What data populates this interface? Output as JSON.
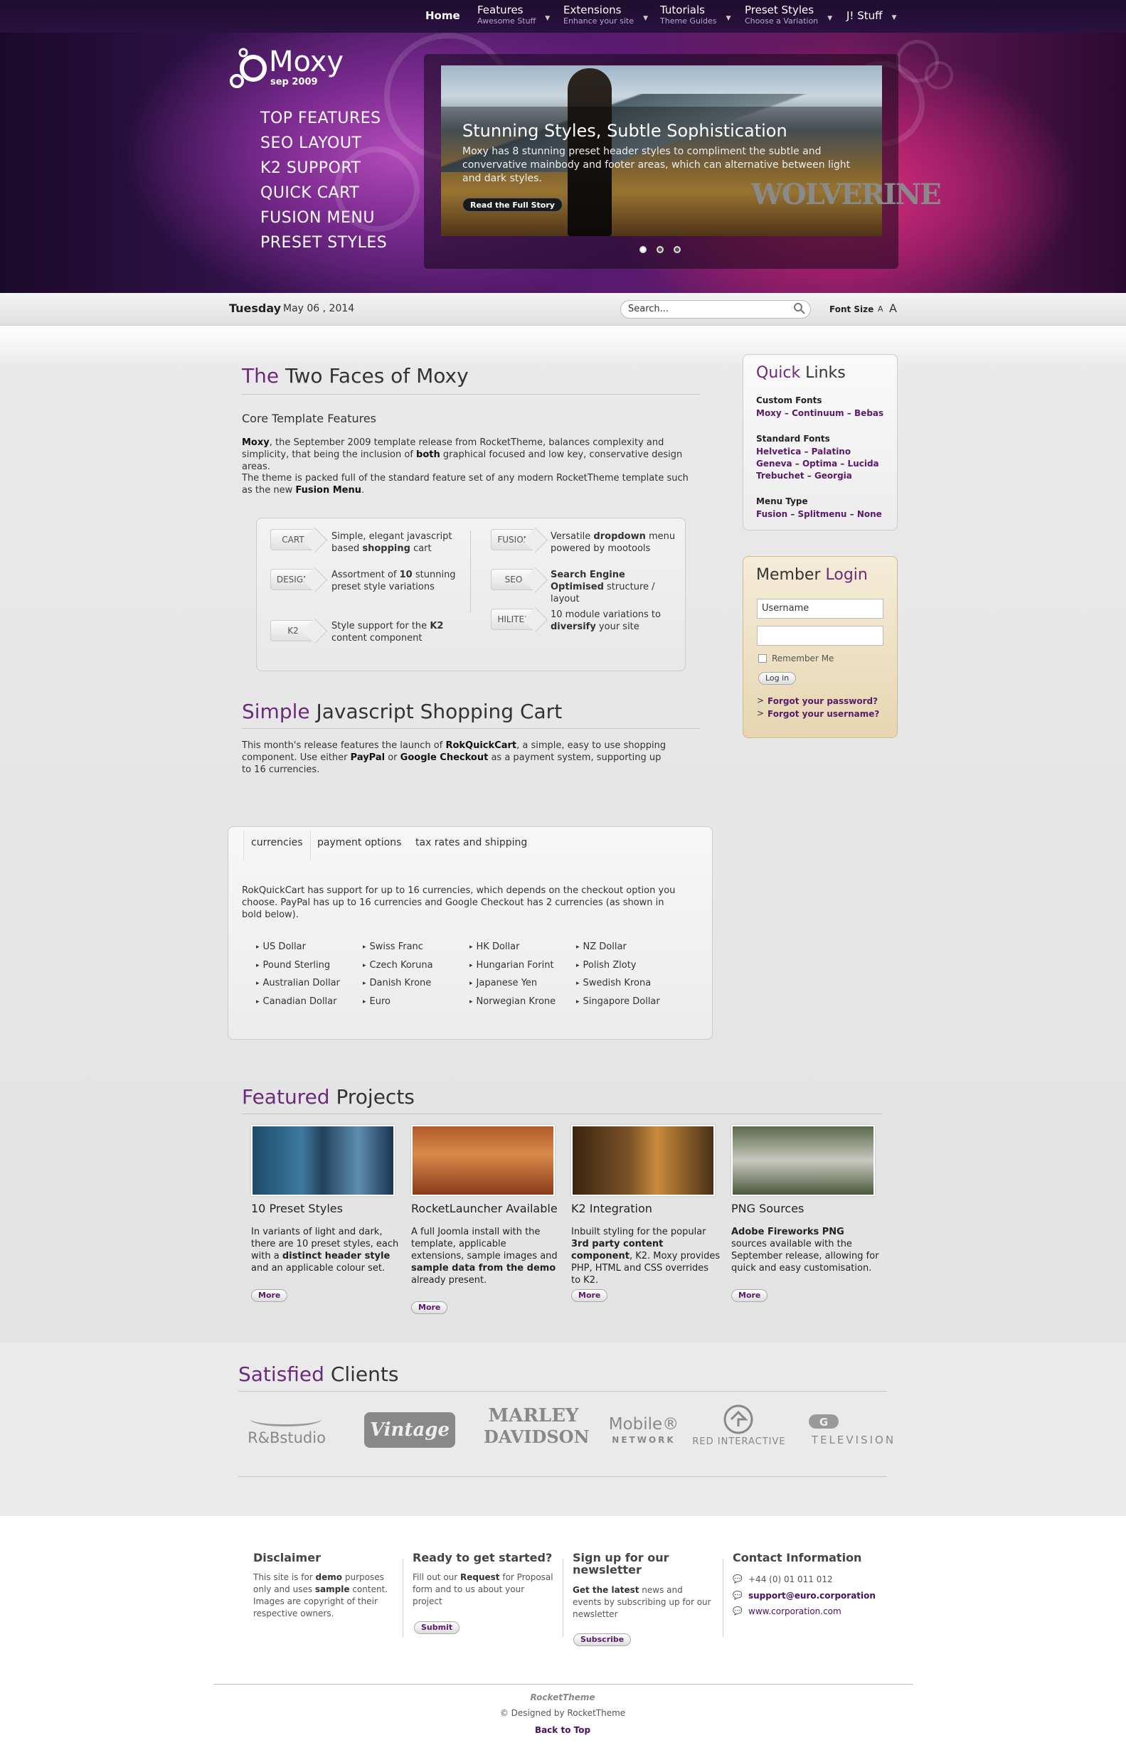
{
  "nav": {
    "home": "Home",
    "items": [
      {
        "label": "Features",
        "sub": "Awesome Stuff"
      },
      {
        "label": "Extensions",
        "sub": "Enhance your site"
      },
      {
        "label": "Tutorials",
        "sub": "Theme Guides"
      },
      {
        "label": "Preset Styles",
        "sub": "Choose a Variation"
      },
      {
        "label": "J! Stuff",
        "sub": ""
      }
    ]
  },
  "header": {
    "logo": "Moxy",
    "logo_sub": "sep 2009",
    "features": [
      "TOP FEATURES",
      "SEO LAYOUT",
      "K2 SUPPORT",
      "QUICK CART",
      "FUSION MENU",
      "PRESET STYLES"
    ]
  },
  "slideshow": {
    "title": "Stunning Styles, Subtle Sophistication",
    "desc": "Moxy has 8 stunning preset header styles to compliment the subtle and convervative mainbody and footer areas, which can alternative between light and dark styles.",
    "button": "Read the Full Story",
    "image_logo": "WOLVERINE"
  },
  "datebar": {
    "day": "Tuesday",
    "date": "May 06 , 2014",
    "search_placeholder": "Search...",
    "font_size_label": "Font Size",
    "a_small": "A",
    "a_large": "A"
  },
  "article1": {
    "title_colored": "The",
    "title_rest": " Two Faces of Moxy",
    "subtitle": "Core Template Features",
    "p1_a": "Moxy",
    "p1_b": ", the September 2009 template release from RocketTheme, balances complexity and simplicity, that being the inclusion of ",
    "p1_c": "both",
    "p1_d": " graphical focused and low key, conservative design areas.",
    "p2_a": "The theme is packed full of the standard feature set of any modern RocketTheme template such as the new ",
    "p2_b": "Fusion Menu",
    "p2_c": "."
  },
  "features_box": [
    {
      "tag": "CART",
      "t1": "Simple, elegant javascript based ",
      "b": "shopping",
      "t2": " cart"
    },
    {
      "tag": "DESIGN",
      "t1": "Assortment of ",
      "b": "10",
      "t2": " stunning preset style variations"
    },
    {
      "tag": "K2",
      "t1": "Style support for the ",
      "b": "K2",
      "t2": " content component"
    },
    {
      "tag": "FUSION",
      "t1": "Versatile ",
      "b": "dropdown",
      "t2": " menu powered by mootools"
    },
    {
      "tag": "SEO",
      "t1": "",
      "b": "Search Engine Optimised",
      "t2": " structure / layout"
    },
    {
      "tag": "HILITES",
      "t1": "10 module variations to ",
      "b": "diversify",
      "t2": " your site"
    }
  ],
  "article2": {
    "title_colored": "Simple",
    "title_rest": " Javascript Shopping Cart",
    "p_a": "This month's release features the launch of ",
    "p_b": "RokQuickCart",
    "p_c": ", a simple, easy to use shopping component. Use either ",
    "p_d": "PayPal",
    "p_e": " or ",
    "p_f": "Google Checkout",
    "p_g": " as a payment system, supporting up to 16 currencies."
  },
  "tabs": {
    "labels": [
      "currencies",
      "payment options",
      "tax rates and shipping"
    ],
    "text": "RokQuickCart has support for up to 16 currencies, which depends on the checkout option you choose. PayPal has up to 16 currencies and Google Checkout has 2 currencies (as shown in bold below).",
    "currencies": [
      [
        "US Dollar",
        "Pound Sterling",
        "Australian Dollar",
        "Canadian Dollar"
      ],
      [
        "Swiss Franc",
        "Czech Koruna",
        "Danish Krone",
        "Euro"
      ],
      [
        "HK Dollar",
        "Hungarian Forint",
        "Japanese Yen",
        "Norwegian Krone"
      ],
      [
        "NZ Dollar",
        "Polish Zloty",
        "Swedish Krona",
        "Singapore Dollar"
      ]
    ]
  },
  "quicklinks": {
    "title_colored": "Quick",
    "title_rest": " Links",
    "g1_head": "Custom Fonts",
    "g1_links": "Moxy – Continuum – Bebas",
    "g2_head": "Standard Fonts",
    "g2_l1": "Helvetica – Palatino",
    "g2_l2": "Geneva – Optima – Lucida",
    "g2_l3": "Trebuchet – Georgia",
    "g3_head": "Menu Type",
    "g3_links": "Fusion – Splitmenu – None"
  },
  "login": {
    "title_a": "Member",
    "title_b": " Login",
    "username_placeholder": "Username",
    "remember": "Remember Me",
    "button": "Log in",
    "forgot_password": "Forgot your password?",
    "forgot_username": "Forgot your username?"
  },
  "featured": {
    "title_colored": "Featured",
    "title_rest": " Projects",
    "more": "More",
    "items": [
      {
        "title": "10 Preset Styles"
      },
      {
        "title": "RocketLauncher Available"
      },
      {
        "title": "K2 Integration"
      },
      {
        "title": "PNG Sources"
      }
    ],
    "d1_a": "In variants of light and dark, there are 10 preset styles, each with a ",
    "d1_b": "distinct header style",
    "d1_c": " and an applicable colour set.",
    "d2_a": "A full Joomla install with the template, applicable extensions, sample images and ",
    "d2_b": "sample data from the demo",
    "d2_c": " already present.",
    "d3_a": "Inbuilt styling for the popular ",
    "d3_b": "3rd party content component",
    "d3_c": ", K2. Moxy provides PHP, HTML and CSS overrides to K2.",
    "d4_a": "Adobe Fireworks PNG",
    "d4_b": " sources available with the September release, allowing for quick and easy customisation."
  },
  "clients": {
    "title_colored": "Satisfied",
    "title_rest": " Clients",
    "logos": [
      "R&Bstudio",
      "Vintage",
      "MARLEY",
      "DAVIDSON",
      "Mobile®",
      "NETWORK",
      "RED INTERACTIVE",
      "TELEVISION"
    ]
  },
  "footer": {
    "c1_head": "Disclaimer",
    "c1_a": "This site is for ",
    "c1_b": "demo",
    "c1_c": " purposes only and uses ",
    "c1_d": "sample",
    "c1_e": " content. Images are copyright of their respective owners.",
    "c2_head": "Ready to get started?",
    "c2_a": "Fill out our ",
    "c2_b": "Request",
    "c2_c": " for Proposal form and to us about your project",
    "c2_btn": "Submit",
    "c3_head": "Sign up for our newsletter",
    "c3_b": "Get the latest",
    "c3_c": " news and events by subscribing up for our newsletter",
    "c3_btn": "Subscribe",
    "c4_head": "Contact Information",
    "phone": "+44 (0) 01 011 012",
    "email": "support@euro.corporation",
    "web": "www.corporation.com",
    "brand": "RocketTheme",
    "designed": "© Designed by RocketTheme",
    "top": "Back to Top"
  }
}
